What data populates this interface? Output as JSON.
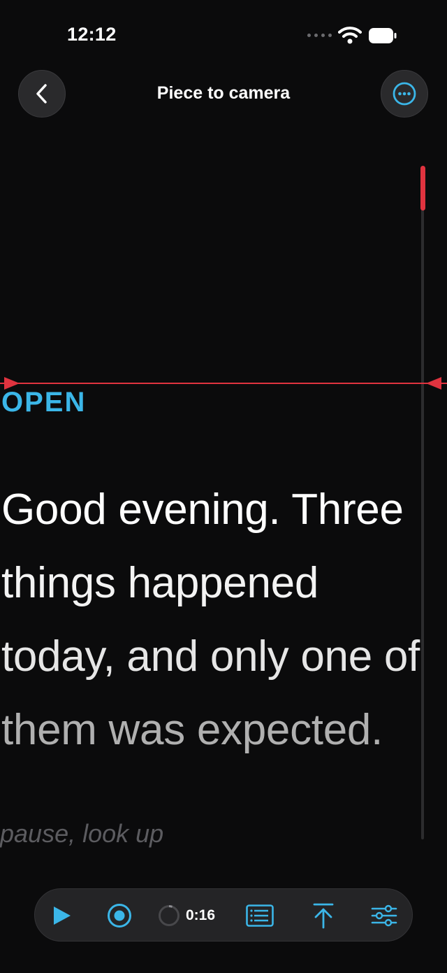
{
  "status_bar": {
    "time": "12:12"
  },
  "nav": {
    "title": "Piece to camera"
  },
  "script": {
    "section_label": "OPEN",
    "lines": [
      "Good evening. Three",
      "things happened",
      "today, and only one of",
      "them was expected."
    ],
    "cue": "pause, look up"
  },
  "toolbar": {
    "timer": "0:16"
  },
  "colors": {
    "accent": "#3bb6e8",
    "guide": "#e0333f",
    "background": "#0b0b0c"
  }
}
